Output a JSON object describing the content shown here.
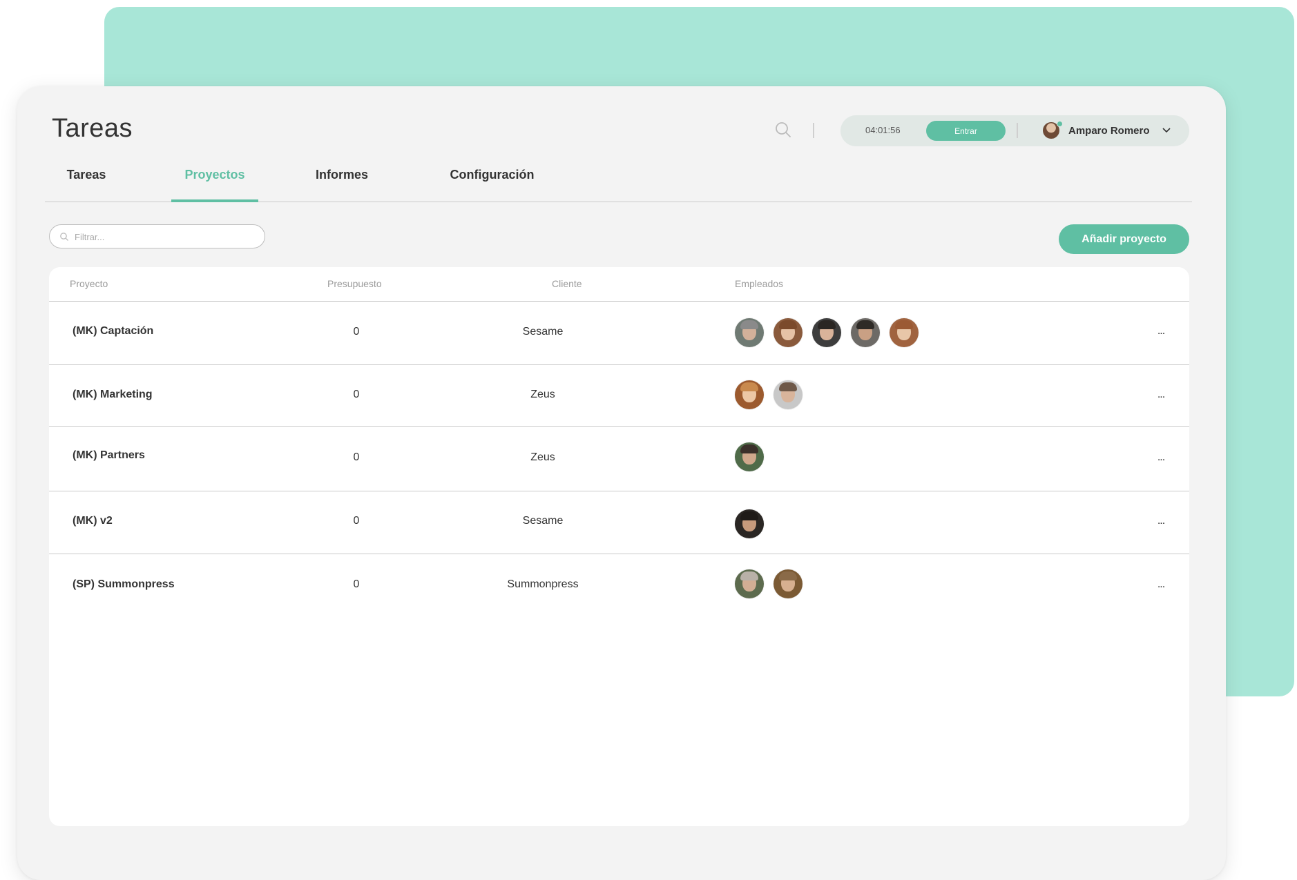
{
  "header": {
    "title": "Tareas",
    "timer": "04:01:56",
    "enter_label": "Entrar",
    "user_name": "Amparo Romero"
  },
  "tabs": [
    {
      "label": "Tareas",
      "active": false
    },
    {
      "label": "Proyectos",
      "active": true
    },
    {
      "label": "Informes",
      "active": false
    },
    {
      "label": "Configuración",
      "active": false
    }
  ],
  "toolbar": {
    "filter_placeholder": "Filtrar...",
    "add_label": "Añadir proyecto"
  },
  "table": {
    "columns": [
      "Proyecto",
      "Presupuesto",
      "Cliente",
      "Empleados"
    ],
    "more_label": "...",
    "rows": [
      {
        "project": "(MK) Captación",
        "budget": "0",
        "client": "Sesame",
        "employees": 5
      },
      {
        "project": "(MK) Marketing",
        "budget": "0",
        "client": "Zeus",
        "employees": 2
      },
      {
        "project": "(MK) Partners",
        "budget": "0",
        "client": "Zeus",
        "employees": 1
      },
      {
        "project": "(MK) v2",
        "budget": "0",
        "client": "Sesame",
        "employees": 1
      },
      {
        "project": "(SP) Summonpress",
        "budget": "0",
        "client": "Summonpress",
        "employees": 2
      }
    ]
  },
  "colors": {
    "accent": "#5fbfa3",
    "background_panel": "#a8e6d7",
    "card": "#f3f3f3"
  }
}
